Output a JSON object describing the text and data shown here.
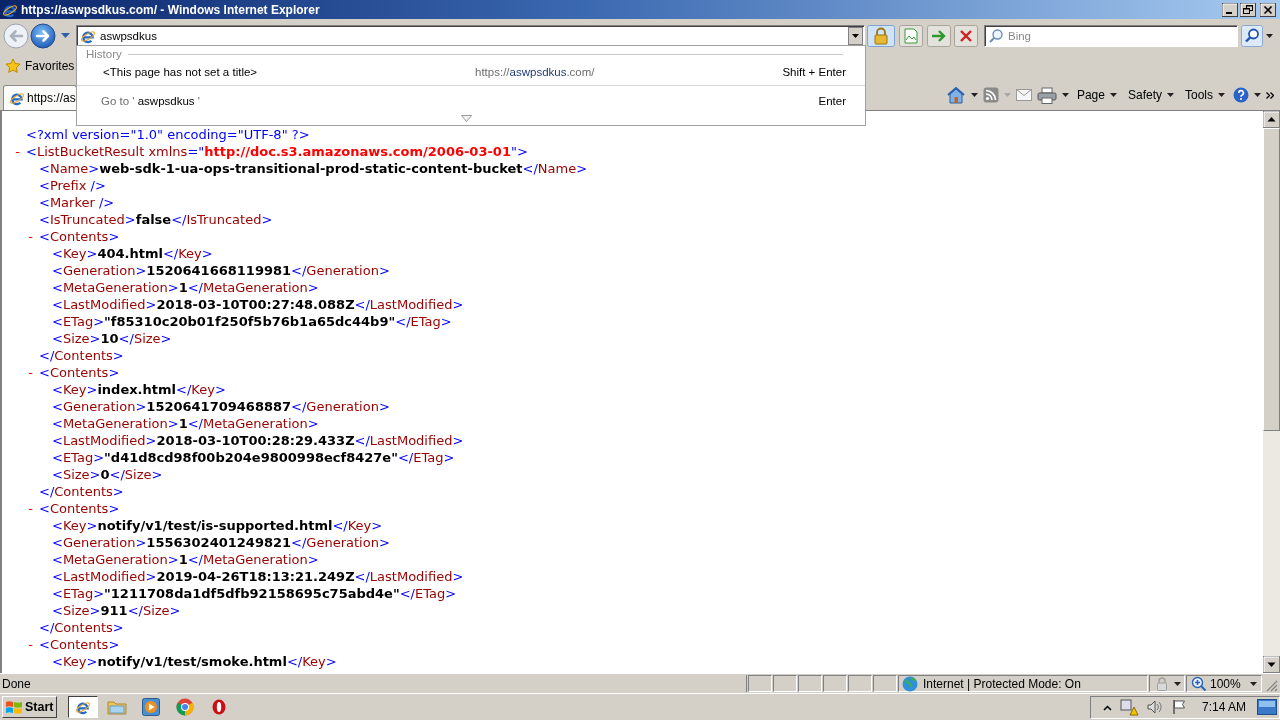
{
  "window": {
    "title": "https://aswpsdkus.com/ - Windows Internet Explorer"
  },
  "address_bar": {
    "value": "aswpsdkus"
  },
  "search": {
    "placeholder": "Bing"
  },
  "address_dropdown": {
    "heading": "History",
    "history": [
      {
        "title": "<This page has not set a title>",
        "url_start": "https://",
        "url_match": "aswpsdkus",
        "url_end": ".com/",
        "shortcut": "Shift + Enter"
      }
    ],
    "go_to": {
      "before": "Go to ' ",
      "query": "aswpsdkus",
      "after": " '",
      "shortcut": "Enter"
    }
  },
  "favorites": {
    "label": "Favorites"
  },
  "tabs": [
    {
      "label": "https://as",
      "selected": true
    }
  ],
  "command_bar": {
    "menus": [
      "Page",
      "Safety",
      "Tools"
    ]
  },
  "xml": {
    "declaration": [
      {
        "kind": "decl",
        "text": "<?xml version=\"1.0\" encoding=\"UTF-8\" ?>"
      }
    ],
    "nodes": [
      {
        "toggle": "-",
        "expanded": true,
        "open": [
          {
            "kind": "markup",
            "text": "<"
          },
          {
            "kind": "tag",
            "text": "ListBucketResult"
          },
          {
            "kind": "attr",
            "text": " xmlns"
          },
          {
            "kind": "markup",
            "text": "=\""
          },
          {
            "kind": "string",
            "text": "http://doc.s3.amazonaws.com/2006-03-01"
          },
          {
            "kind": "markup",
            "text": "\">"
          }
        ],
        "children": [
          {
            "line": [
              {
                "kind": "markup",
                "text": "<"
              },
              {
                "kind": "tag",
                "text": "Name"
              },
              {
                "kind": "markup",
                "text": ">"
              },
              {
                "kind": "value",
                "text": "web-sdk-1-ua-ops-transitional-prod-static-content-bucket"
              },
              {
                "kind": "markup",
                "text": "</"
              },
              {
                "kind": "tag",
                "text": "Name"
              },
              {
                "kind": "markup",
                "text": ">"
              }
            ]
          },
          {
            "line": [
              {
                "kind": "markup",
                "text": "<"
              },
              {
                "kind": "tag",
                "text": "Prefix"
              },
              {
                "kind": "markup",
                "text": " />"
              }
            ]
          },
          {
            "line": [
              {
                "kind": "markup",
                "text": "<"
              },
              {
                "kind": "tag",
                "text": "Marker"
              },
              {
                "kind": "markup",
                "text": " />"
              }
            ]
          },
          {
            "line": [
              {
                "kind": "markup",
                "text": "<"
              },
              {
                "kind": "tag",
                "text": "IsTruncated"
              },
              {
                "kind": "markup",
                "text": ">"
              },
              {
                "kind": "value",
                "text": "false"
              },
              {
                "kind": "markup",
                "text": "</"
              },
              {
                "kind": "tag",
                "text": "IsTruncated"
              },
              {
                "kind": "markup",
                "text": ">"
              }
            ]
          },
          {
            "toggle": "-",
            "expanded": true,
            "open": [
              {
                "kind": "markup",
                "text": "<"
              },
              {
                "kind": "tag",
                "text": "Contents"
              },
              {
                "kind": "markup",
                "text": ">"
              }
            ],
            "children": [
              {
                "line": [
                  {
                    "kind": "markup",
                    "text": "<"
                  },
                  {
                    "kind": "tag",
                    "text": "Key"
                  },
                  {
                    "kind": "markup",
                    "text": ">"
                  },
                  {
                    "kind": "value",
                    "text": "404.html"
                  },
                  {
                    "kind": "markup",
                    "text": "</"
                  },
                  {
                    "kind": "tag",
                    "text": "Key"
                  },
                  {
                    "kind": "markup",
                    "text": ">"
                  }
                ]
              },
              {
                "line": [
                  {
                    "kind": "markup",
                    "text": "<"
                  },
                  {
                    "kind": "tag",
                    "text": "Generation"
                  },
                  {
                    "kind": "markup",
                    "text": ">"
                  },
                  {
                    "kind": "value",
                    "text": "1520641668119981"
                  },
                  {
                    "kind": "markup",
                    "text": "</"
                  },
                  {
                    "kind": "tag",
                    "text": "Generation"
                  },
                  {
                    "kind": "markup",
                    "text": ">"
                  }
                ]
              },
              {
                "line": [
                  {
                    "kind": "markup",
                    "text": "<"
                  },
                  {
                    "kind": "tag",
                    "text": "MetaGeneration"
                  },
                  {
                    "kind": "markup",
                    "text": ">"
                  },
                  {
                    "kind": "value",
                    "text": "1"
                  },
                  {
                    "kind": "markup",
                    "text": "</"
                  },
                  {
                    "kind": "tag",
                    "text": "MetaGeneration"
                  },
                  {
                    "kind": "markup",
                    "text": ">"
                  }
                ]
              },
              {
                "line": [
                  {
                    "kind": "markup",
                    "text": "<"
                  },
                  {
                    "kind": "tag",
                    "text": "LastModified"
                  },
                  {
                    "kind": "markup",
                    "text": ">"
                  },
                  {
                    "kind": "value",
                    "text": "2018-03-10T00:27:48.088Z"
                  },
                  {
                    "kind": "markup",
                    "text": "</"
                  },
                  {
                    "kind": "tag",
                    "text": "LastModified"
                  },
                  {
                    "kind": "markup",
                    "text": ">"
                  }
                ]
              },
              {
                "line": [
                  {
                    "kind": "markup",
                    "text": "<"
                  },
                  {
                    "kind": "tag",
                    "text": "ETag"
                  },
                  {
                    "kind": "markup",
                    "text": ">"
                  },
                  {
                    "kind": "value",
                    "text": "\"f85310c20b01f250f5b76b1a65dc44b9\""
                  },
                  {
                    "kind": "markup",
                    "text": "</"
                  },
                  {
                    "kind": "tag",
                    "text": "ETag"
                  },
                  {
                    "kind": "markup",
                    "text": ">"
                  }
                ]
              },
              {
                "line": [
                  {
                    "kind": "markup",
                    "text": "<"
                  },
                  {
                    "kind": "tag",
                    "text": "Size"
                  },
                  {
                    "kind": "markup",
                    "text": ">"
                  },
                  {
                    "kind": "value",
                    "text": "10"
                  },
                  {
                    "kind": "markup",
                    "text": "</"
                  },
                  {
                    "kind": "tag",
                    "text": "Size"
                  },
                  {
                    "kind": "markup",
                    "text": ">"
                  }
                ]
              }
            ],
            "close": [
              {
                "kind": "markup",
                "text": "</"
              },
              {
                "kind": "tag",
                "text": "Contents"
              },
              {
                "kind": "markup",
                "text": ">"
              }
            ]
          },
          {
            "toggle": "-",
            "expanded": true,
            "open": [
              {
                "kind": "markup",
                "text": "<"
              },
              {
                "kind": "tag",
                "text": "Contents"
              },
              {
                "kind": "markup",
                "text": ">"
              }
            ],
            "children": [
              {
                "line": [
                  {
                    "kind": "markup",
                    "text": "<"
                  },
                  {
                    "kind": "tag",
                    "text": "Key"
                  },
                  {
                    "kind": "markup",
                    "text": ">"
                  },
                  {
                    "kind": "value",
                    "text": "index.html"
                  },
                  {
                    "kind": "markup",
                    "text": "</"
                  },
                  {
                    "kind": "tag",
                    "text": "Key"
                  },
                  {
                    "kind": "markup",
                    "text": ">"
                  }
                ]
              },
              {
                "line": [
                  {
                    "kind": "markup",
                    "text": "<"
                  },
                  {
                    "kind": "tag",
                    "text": "Generation"
                  },
                  {
                    "kind": "markup",
                    "text": ">"
                  },
                  {
                    "kind": "value",
                    "text": "1520641709468887"
                  },
                  {
                    "kind": "markup",
                    "text": "</"
                  },
                  {
                    "kind": "tag",
                    "text": "Generation"
                  },
                  {
                    "kind": "markup",
                    "text": ">"
                  }
                ]
              },
              {
                "line": [
                  {
                    "kind": "markup",
                    "text": "<"
                  },
                  {
                    "kind": "tag",
                    "text": "MetaGeneration"
                  },
                  {
                    "kind": "markup",
                    "text": ">"
                  },
                  {
                    "kind": "value",
                    "text": "1"
                  },
                  {
                    "kind": "markup",
                    "text": "</"
                  },
                  {
                    "kind": "tag",
                    "text": "MetaGeneration"
                  },
                  {
                    "kind": "markup",
                    "text": ">"
                  }
                ]
              },
              {
                "line": [
                  {
                    "kind": "markup",
                    "text": "<"
                  },
                  {
                    "kind": "tag",
                    "text": "LastModified"
                  },
                  {
                    "kind": "markup",
                    "text": ">"
                  },
                  {
                    "kind": "value",
                    "text": "2018-03-10T00:28:29.433Z"
                  },
                  {
                    "kind": "markup",
                    "text": "</"
                  },
                  {
                    "kind": "tag",
                    "text": "LastModified"
                  },
                  {
                    "kind": "markup",
                    "text": ">"
                  }
                ]
              },
              {
                "line": [
                  {
                    "kind": "markup",
                    "text": "<"
                  },
                  {
                    "kind": "tag",
                    "text": "ETag"
                  },
                  {
                    "kind": "markup",
                    "text": ">"
                  },
                  {
                    "kind": "value",
                    "text": "\"d41d8cd98f00b204e9800998ecf8427e\""
                  },
                  {
                    "kind": "markup",
                    "text": "</"
                  },
                  {
                    "kind": "tag",
                    "text": "ETag"
                  },
                  {
                    "kind": "markup",
                    "text": ">"
                  }
                ]
              },
              {
                "line": [
                  {
                    "kind": "markup",
                    "text": "<"
                  },
                  {
                    "kind": "tag",
                    "text": "Size"
                  },
                  {
                    "kind": "markup",
                    "text": ">"
                  },
                  {
                    "kind": "value",
                    "text": "0"
                  },
                  {
                    "kind": "markup",
                    "text": "</"
                  },
                  {
                    "kind": "tag",
                    "text": "Size"
                  },
                  {
                    "kind": "markup",
                    "text": ">"
                  }
                ]
              }
            ],
            "close": [
              {
                "kind": "markup",
                "text": "</"
              },
              {
                "kind": "tag",
                "text": "Contents"
              },
              {
                "kind": "markup",
                "text": ">"
              }
            ]
          },
          {
            "toggle": "-",
            "expanded": true,
            "open": [
              {
                "kind": "markup",
                "text": "<"
              },
              {
                "kind": "tag",
                "text": "Contents"
              },
              {
                "kind": "markup",
                "text": ">"
              }
            ],
            "children": [
              {
                "line": [
                  {
                    "kind": "markup",
                    "text": "<"
                  },
                  {
                    "kind": "tag",
                    "text": "Key"
                  },
                  {
                    "kind": "markup",
                    "text": ">"
                  },
                  {
                    "kind": "value",
                    "text": "notify/v1/test/is-supported.html"
                  },
                  {
                    "kind": "markup",
                    "text": "</"
                  },
                  {
                    "kind": "tag",
                    "text": "Key"
                  },
                  {
                    "kind": "markup",
                    "text": ">"
                  }
                ]
              },
              {
                "line": [
                  {
                    "kind": "markup",
                    "text": "<"
                  },
                  {
                    "kind": "tag",
                    "text": "Generation"
                  },
                  {
                    "kind": "markup",
                    "text": ">"
                  },
                  {
                    "kind": "value",
                    "text": "1556302401249821"
                  },
                  {
                    "kind": "markup",
                    "text": "</"
                  },
                  {
                    "kind": "tag",
                    "text": "Generation"
                  },
                  {
                    "kind": "markup",
                    "text": ">"
                  }
                ]
              },
              {
                "line": [
                  {
                    "kind": "markup",
                    "text": "<"
                  },
                  {
                    "kind": "tag",
                    "text": "MetaGeneration"
                  },
                  {
                    "kind": "markup",
                    "text": ">"
                  },
                  {
                    "kind": "value",
                    "text": "1"
                  },
                  {
                    "kind": "markup",
                    "text": "</"
                  },
                  {
                    "kind": "tag",
                    "text": "MetaGeneration"
                  },
                  {
                    "kind": "markup",
                    "text": ">"
                  }
                ]
              },
              {
                "line": [
                  {
                    "kind": "markup",
                    "text": "<"
                  },
                  {
                    "kind": "tag",
                    "text": "LastModified"
                  },
                  {
                    "kind": "markup",
                    "text": ">"
                  },
                  {
                    "kind": "value",
                    "text": "2019-04-26T18:13:21.249Z"
                  },
                  {
                    "kind": "markup",
                    "text": "</"
                  },
                  {
                    "kind": "tag",
                    "text": "LastModified"
                  },
                  {
                    "kind": "markup",
                    "text": ">"
                  }
                ]
              },
              {
                "line": [
                  {
                    "kind": "markup",
                    "text": "<"
                  },
                  {
                    "kind": "tag",
                    "text": "ETag"
                  },
                  {
                    "kind": "markup",
                    "text": ">"
                  },
                  {
                    "kind": "value",
                    "text": "\"1211708da1df5dfb92158695c75abd4e\""
                  },
                  {
                    "kind": "markup",
                    "text": "</"
                  },
                  {
                    "kind": "tag",
                    "text": "ETag"
                  },
                  {
                    "kind": "markup",
                    "text": ">"
                  }
                ]
              },
              {
                "line": [
                  {
                    "kind": "markup",
                    "text": "<"
                  },
                  {
                    "kind": "tag",
                    "text": "Size"
                  },
                  {
                    "kind": "markup",
                    "text": ">"
                  },
                  {
                    "kind": "value",
                    "text": "911"
                  },
                  {
                    "kind": "markup",
                    "text": "</"
                  },
                  {
                    "kind": "tag",
                    "text": "Size"
                  },
                  {
                    "kind": "markup",
                    "text": ">"
                  }
                ]
              }
            ],
            "close": [
              {
                "kind": "markup",
                "text": "</"
              },
              {
                "kind": "tag",
                "text": "Contents"
              },
              {
                "kind": "markup",
                "text": ">"
              }
            ]
          },
          {
            "toggle": "-",
            "expanded": true,
            "open": [
              {
                "kind": "markup",
                "text": "<"
              },
              {
                "kind": "tag",
                "text": "Contents"
              },
              {
                "kind": "markup",
                "text": ">"
              }
            ],
            "children": [
              {
                "line": [
                  {
                    "kind": "markup",
                    "text": "<"
                  },
                  {
                    "kind": "tag",
                    "text": "Key"
                  },
                  {
                    "kind": "markup",
                    "text": ">"
                  },
                  {
                    "kind": "value",
                    "text": "notify/v1/test/smoke.html"
                  },
                  {
                    "kind": "markup",
                    "text": "</"
                  },
                  {
                    "kind": "tag",
                    "text": "Key"
                  },
                  {
                    "kind": "markup",
                    "text": ">"
                  }
                ]
              }
            ]
          }
        ]
      }
    ]
  },
  "status_bar": {
    "text": "Done",
    "zone": "Internet | Protected Mode: On",
    "zoom": "100%"
  },
  "taskbar": {
    "start": "Start",
    "buttons": [
      {
        "selected": true
      },
      {
        "selected": false
      },
      {
        "selected": false
      },
      {
        "selected": false
      },
      {
        "selected": false
      }
    ],
    "clock": "7:14 AM"
  }
}
